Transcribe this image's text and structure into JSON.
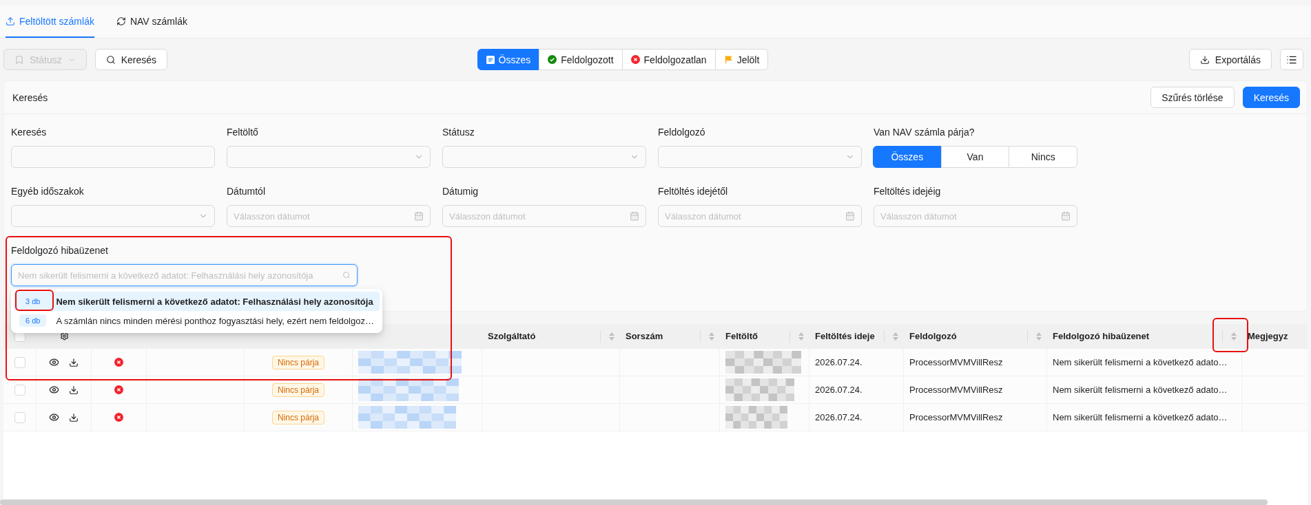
{
  "tabs": [
    {
      "label": "Feltöltött számlák",
      "kind": "upload",
      "selected": true
    },
    {
      "label": "NAV számlák",
      "kind": "sync",
      "selected": false
    }
  ],
  "toolbar": {
    "status_button": {
      "label": "Státusz",
      "disabled": true
    },
    "search_button": {
      "label": "Keresés"
    },
    "segments": [
      {
        "label": "Összes",
        "kind": "all",
        "selected": true
      },
      {
        "label": "Feldolgozott",
        "kind": "done",
        "selected": false
      },
      {
        "label": "Feldolgozatlan",
        "kind": "failed",
        "selected": false
      },
      {
        "label": "Jelölt",
        "kind": "flagged",
        "selected": false
      }
    ],
    "export_button": {
      "label": "Exportálás"
    }
  },
  "filter_panel": {
    "title": "Keresés",
    "clear_button": "Szűrés törlése",
    "search_button": "Keresés",
    "fields": [
      {
        "label": "Keresés",
        "kind": "text"
      },
      {
        "label": "Feltöltő",
        "kind": "select"
      },
      {
        "label": "Státusz",
        "kind": "select"
      },
      {
        "label": "Feldolgozó",
        "kind": "select"
      },
      {
        "label": "Van NAV számla párja?",
        "kind": "segmented",
        "options": [
          {
            "label": "Összes",
            "selected": true
          },
          {
            "label": "Van",
            "selected": false
          },
          {
            "label": "Nincs",
            "selected": false
          }
        ]
      },
      {
        "label": "Egyéb időszakok",
        "kind": "select"
      },
      {
        "label": "Dátumtól",
        "kind": "date",
        "placeholder": "Válasszon dátumot"
      },
      {
        "label": "Dátumig",
        "kind": "date",
        "placeholder": "Válasszon dátumot"
      },
      {
        "label": "Feltöltés idejétől",
        "kind": "date",
        "placeholder": "Válasszon dátumot"
      },
      {
        "label": "Feltöltés idejéig",
        "kind": "date",
        "placeholder": "Válasszon dátumot"
      }
    ],
    "error_field": {
      "label": "Feldolgozó hibaüzenet",
      "placeholder": "Nem sikerült felismerni a következő adatot: Felhasználási hely azonosítója",
      "focused": true,
      "options": [
        {
          "count": "3 db",
          "text": "Nem sikerült felismerni a következő adatot: Felhasználási hely azonosítója",
          "selected": true
        },
        {
          "count": "6 db",
          "text": "A számlán nincs minden mérési ponthoz fogyasztási hely, ezért nem feldolgoz…",
          "selected": false
        }
      ]
    }
  },
  "table": {
    "header_checked": false,
    "columns": [
      {
        "kind": "check"
      },
      {
        "kind": "settings"
      },
      {
        "kind": "plain"
      },
      {
        "kind": "plain"
      },
      {
        "kind": "plain"
      },
      {
        "kind": "plain"
      },
      {
        "label": "Szolgáltató",
        "kind": "sortable"
      },
      {
        "label": "Sorszám",
        "kind": "sortable"
      },
      {
        "label": "Feltöltő",
        "kind": "sortable"
      },
      {
        "label": "Feltöltés ideje",
        "kind": "sortable"
      },
      {
        "label": "Feldolgozó",
        "kind": "sortable"
      },
      {
        "label": "Feldolgozó hibaüzenet",
        "kind": "sortable"
      },
      {
        "label": "Megjegyz",
        "kind": "plain"
      }
    ],
    "rows": [
      {
        "checked": false,
        "failed": true,
        "nav_pair": "Nincs párja",
        "uploaded": "2026.07.24.",
        "processor": "ProcessorMVMVillResz",
        "error": "Nem sikerült felismerni a következő adato…"
      },
      {
        "checked": false,
        "failed": true,
        "nav_pair": "Nincs párja",
        "uploaded": "2026.07.24.",
        "processor": "ProcessorMVMVillResz",
        "error": "Nem sikerült felismerni a következő adato…"
      },
      {
        "checked": false,
        "failed": true,
        "nav_pair": "Nincs párja",
        "uploaded": "2026.07.24.",
        "processor": "ProcessorMVMVillResz",
        "error": "Nem sikerült felismerni a következő adato…"
      }
    ]
  }
}
